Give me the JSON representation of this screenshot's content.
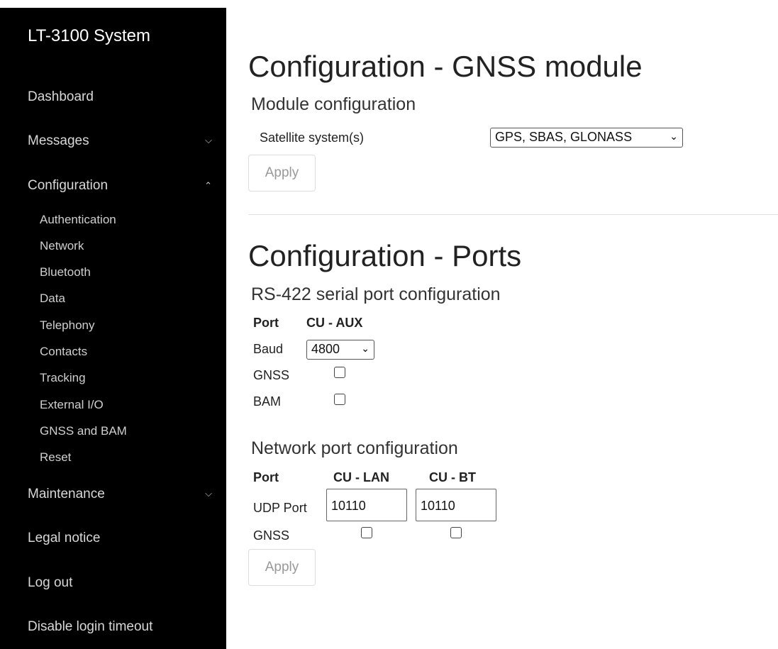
{
  "app": {
    "title": "LT-3100 System"
  },
  "sidebar": {
    "items": [
      {
        "label": "Dashboard",
        "chevron": ""
      },
      {
        "label": "Messages",
        "chevron": "⌄"
      },
      {
        "label": "Configuration",
        "chevron": "^"
      },
      {
        "label": "Maintenance",
        "chevron": "⌄"
      },
      {
        "label": "Legal notice",
        "chevron": ""
      },
      {
        "label": "Log out",
        "chevron": ""
      },
      {
        "label": "Disable login timeout",
        "chevron": ""
      }
    ],
    "config_subitems": [
      "Authentication",
      "Network",
      "Bluetooth",
      "Data",
      "Telephony",
      "Contacts",
      "Tracking",
      "External I/O",
      "GNSS and BAM",
      "Reset"
    ]
  },
  "gnss": {
    "title": "Configuration - GNSS module",
    "section": "Module configuration",
    "satellite_label": "Satellite system(s)",
    "satellite_value": "GPS, SBAS, GLONASS",
    "apply": "Apply"
  },
  "ports": {
    "title": "Configuration - Ports",
    "rs422": {
      "heading": "RS-422 serial port configuration",
      "port_label": "Port",
      "port_name": "CU - AUX",
      "baud_label": "Baud",
      "baud_value": "4800",
      "gnss_label": "GNSS",
      "gnss_checked": false,
      "bam_label": "BAM",
      "bam_checked": false
    },
    "network": {
      "heading": "Network port configuration",
      "port_label": "Port",
      "col1": "CU - LAN",
      "col2": "CU - BT",
      "udp_label": "UDP Port",
      "udp1": "10110",
      "udp2": "10110",
      "gnss_label": "GNSS",
      "gnss1_checked": false,
      "gnss2_checked": false
    },
    "apply": "Apply"
  },
  "icons": {
    "chevron_down": "chevron-down-icon",
    "chevron_up": "chevron-up-icon",
    "select_caret": "caret-down-icon"
  }
}
